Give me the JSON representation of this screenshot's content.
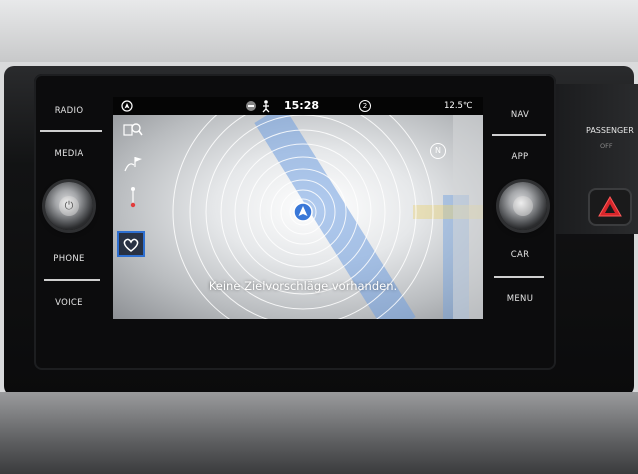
{
  "hardware_buttons": {
    "radio": "RADIO",
    "media": "MEDIA",
    "phone": "PHONE",
    "voice": "VOICE",
    "nav": "NAV",
    "app": "APP",
    "car": "CAR",
    "menu": "MENU"
  },
  "passenger_panel": {
    "label": "PASSENGER",
    "state": "OFF"
  },
  "status_bar": {
    "time": "15:28",
    "temperature": "12.5℃",
    "notification_count": "2"
  },
  "map": {
    "empty_message": "Keine Zielvorschläge vorhanden.",
    "compass_label": "N"
  },
  "colors": {
    "accent_blue": "#2e6fd1",
    "position_marker": "#3a78d8",
    "hazard_red": "#d8262b"
  }
}
